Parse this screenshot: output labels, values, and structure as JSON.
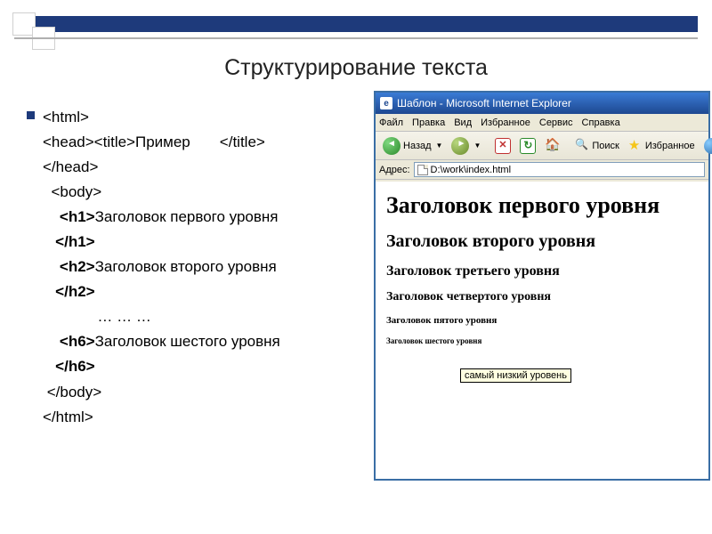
{
  "slide": {
    "title": "Структурирование текста"
  },
  "code": {
    "l1": "<html>",
    "l2": "<head><title>Пример       </title>",
    "l3": "</head>",
    "l4": "  <body>",
    "l5a": "    <h1>",
    "l5b": "Заголовок первого уровня",
    "l5c": "   </h1>",
    "l6a": "    <h2>",
    "l6b": "Заголовок второго уровня",
    "l6c": "   </h2>",
    "l7": "             … … …",
    "l8a": "    <h6>",
    "l8b": "Заголовок шестого уровня",
    "l8c": "   </h6>",
    "l9": " </body>",
    "l10": "</html>"
  },
  "ie": {
    "title": "Шаблон - Microsoft Internet Explorer",
    "menu": {
      "file": "Файл",
      "edit": "Правка",
      "view": "Вид",
      "favorites": "Избранное",
      "tools": "Сервис",
      "help": "Справка"
    },
    "toolbar": {
      "back": "Назад",
      "search": "Поиск",
      "favorites": "Избранное"
    },
    "address_label": "Адрес:",
    "address_value": "D:\\work\\index.html",
    "headings": {
      "h1": "Заголовок первого уровня",
      "h2": "Заголовок второго уровня",
      "h3": "Заголовок третьего уровня",
      "h4": "Заголовок четвертого уровня",
      "h5": "Заголовок пятого уровня",
      "h6": "Заголовок шестого уровня"
    },
    "tooltip": "самый низкий уровень"
  }
}
